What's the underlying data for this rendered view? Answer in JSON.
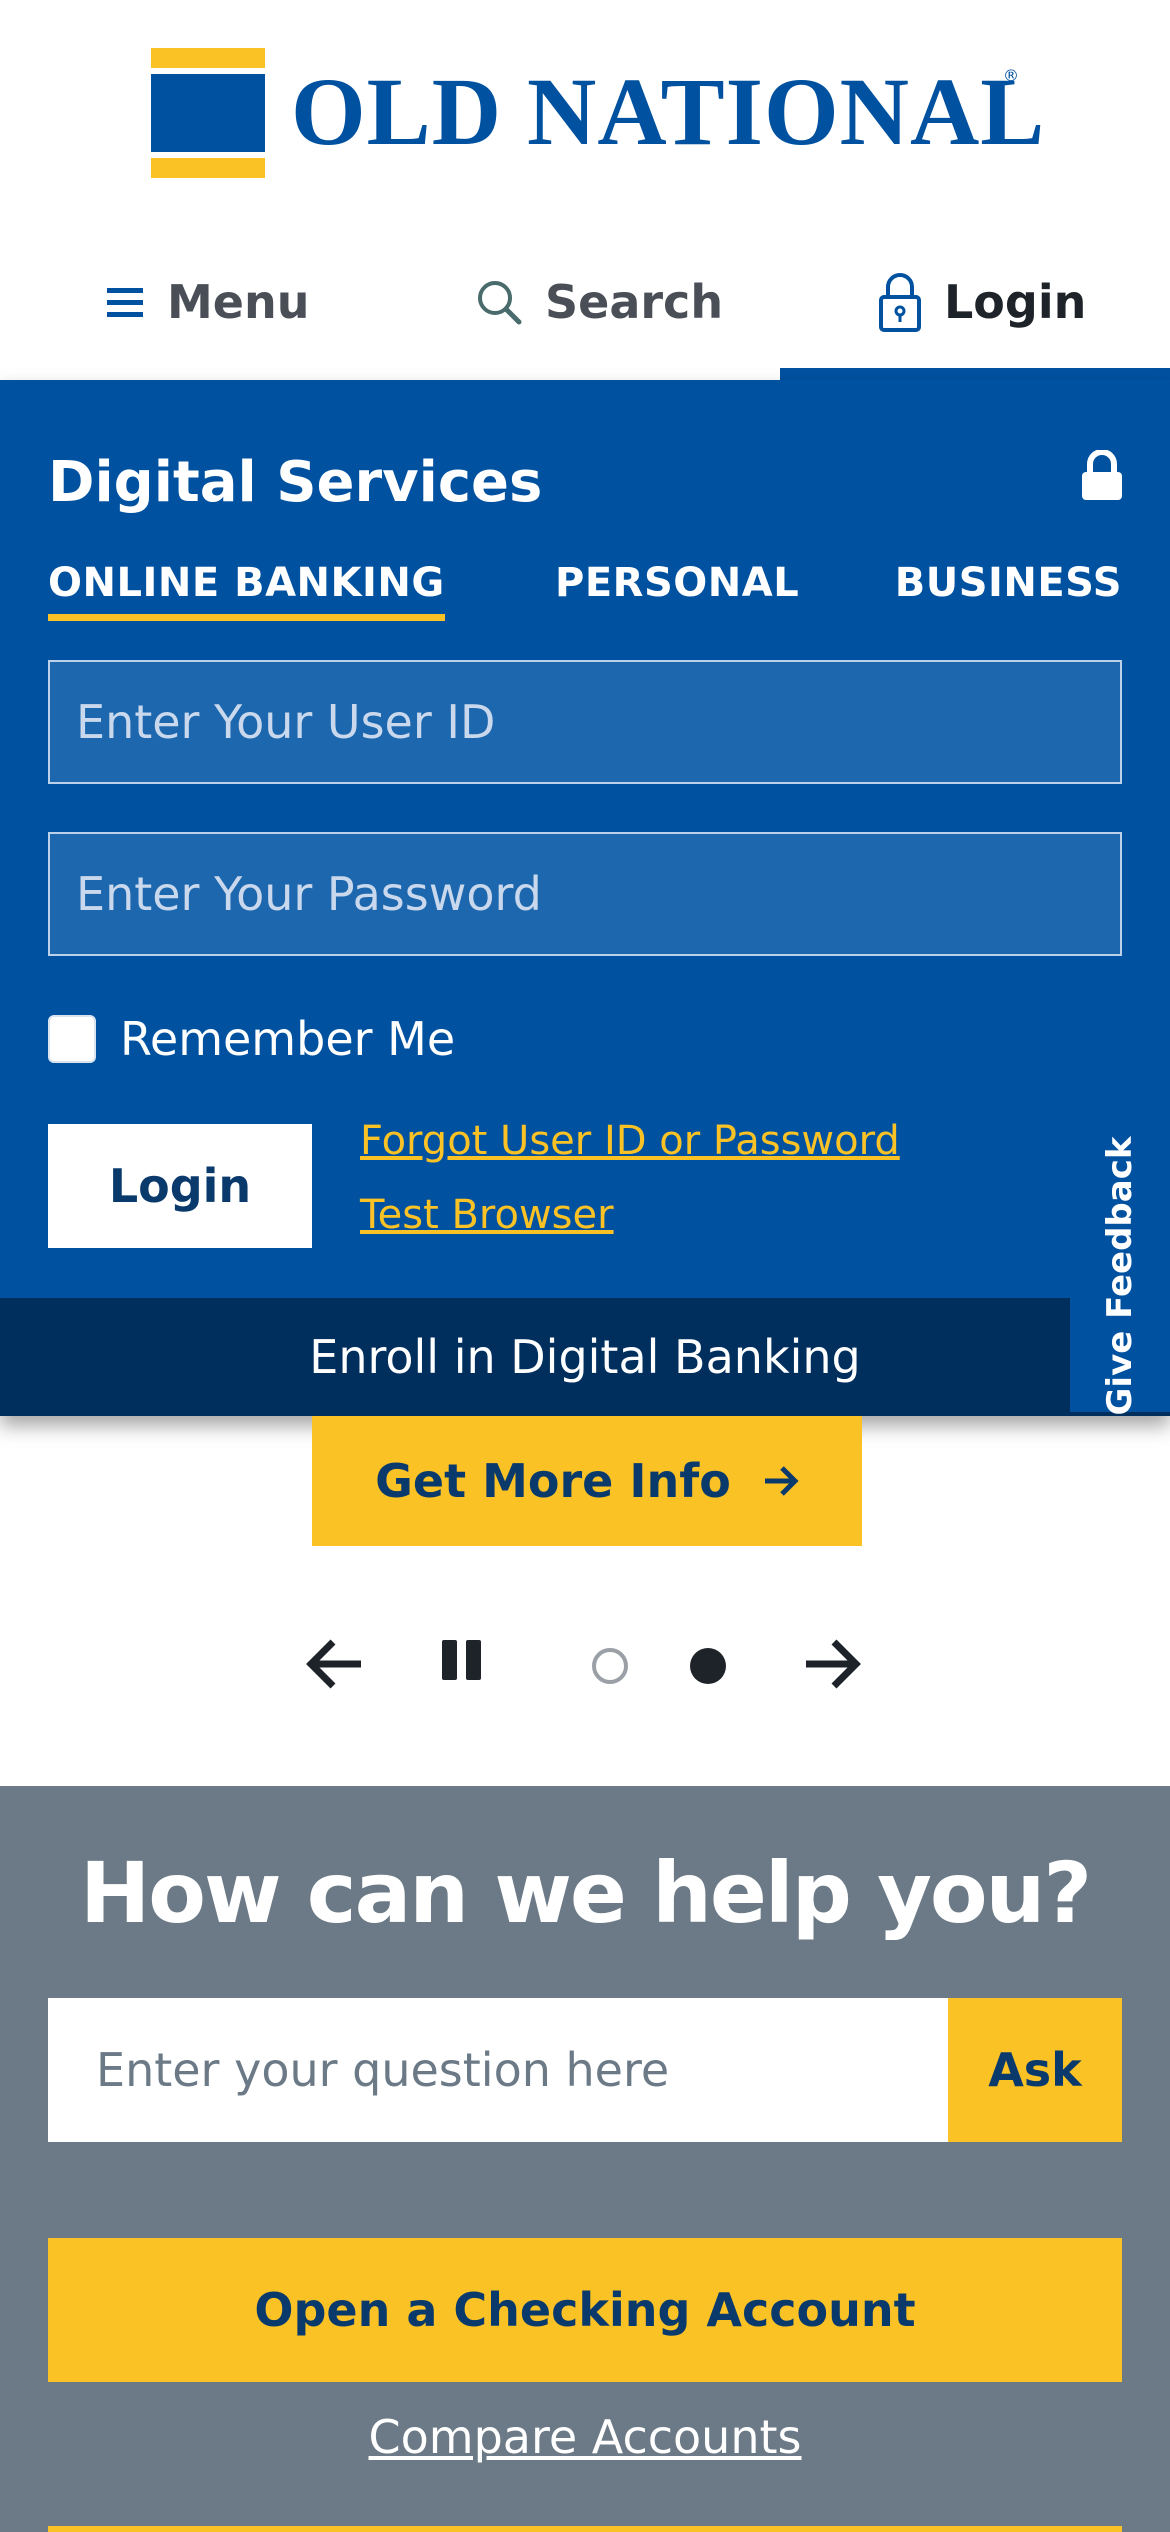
{
  "brand": {
    "name": "OLD NATIONAL",
    "registered_mark": "®",
    "colors": {
      "primary": "#0051a0",
      "accent": "#fbc226",
      "dark": "#002f5e",
      "gray": "#6b7a86"
    }
  },
  "nav": {
    "menu_label": "Menu",
    "search_label": "Search",
    "login_label": "Login",
    "active": "Login"
  },
  "login_panel": {
    "title": "Digital Services",
    "tabs": [
      "ONLINE BANKING",
      "PERSONAL",
      "BUSINESS"
    ],
    "active_tab": "ONLINE BANKING",
    "user_id_placeholder": "Enter Your User ID",
    "password_placeholder": "Enter Your Password",
    "remember_label": "Remember Me",
    "remember_checked": false,
    "login_button": "Login",
    "forgot_link": "Forgot User ID or Password",
    "test_browser_link": "Test Browser",
    "enroll_label": "Enroll in Digital Banking",
    "feedback_label": "Give Feedback"
  },
  "hero": {
    "cta_label": "Get More Info",
    "carousel": {
      "slide_count": 2,
      "active_slide": 2
    }
  },
  "help": {
    "title": "How can we help you?",
    "ask_placeholder": "Enter your question here",
    "ask_button": "Ask",
    "open_checking_button": "Open a Checking Account",
    "compare_link": "Compare Accounts"
  }
}
